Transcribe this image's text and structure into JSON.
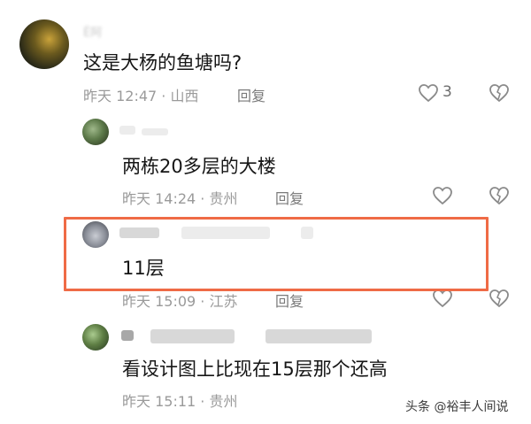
{
  "comments": {
    "root": {
      "username": "Ё阿",
      "text": "这是大杨的鱼塘吗?",
      "meta": "昨天 12:47 · 山西",
      "reply_label": "回复",
      "like_count": "3"
    },
    "replies": [
      {
        "text": "两栋20多层的大楼",
        "meta": "昨天 14:24 · 贵州",
        "reply_label": "回复"
      },
      {
        "text": "11层",
        "meta": "昨天 15:09 · 江苏",
        "reply_label": "回复"
      },
      {
        "text": "看设计图上比现在15层那个还高",
        "meta": "昨天 15:11 · 贵州",
        "reply_label": "回复"
      }
    ]
  },
  "watermark": "头条 @裕丰人间说",
  "colors": {
    "highlight": "#ef6b46",
    "text": "#161616",
    "meta": "#9a9a9a"
  },
  "icons": {
    "like": "heart-outline-icon",
    "dislike": "broken-heart-icon"
  }
}
